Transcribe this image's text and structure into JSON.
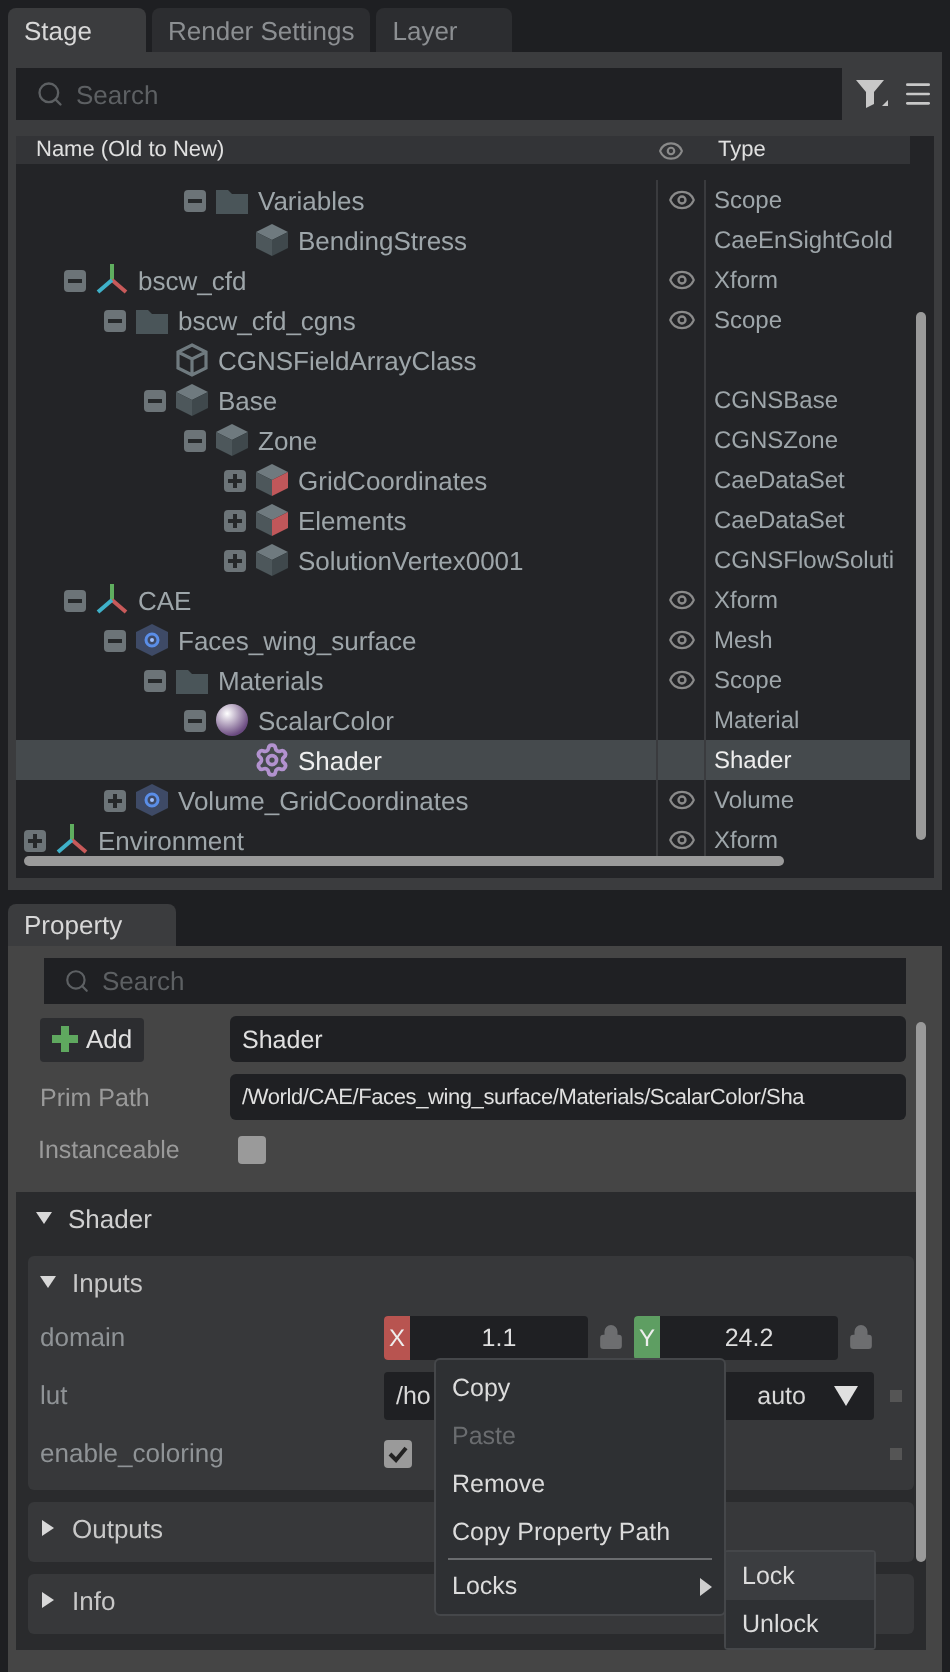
{
  "stage_tabs": [
    {
      "label": "Stage",
      "selected": true
    },
    {
      "label": "Render Settings",
      "selected": false
    },
    {
      "label": "Layer",
      "selected": false
    }
  ],
  "stage_search": {
    "placeholder": "Search"
  },
  "tree_columns": {
    "name": "Name (Old to New)",
    "type": "Type"
  },
  "tree": [
    {
      "children": [
        {
          "children": [
            {
              "children": [
                {
                  "children": [
                    {
                      "name": "Variables",
                      "kind": "folder",
                      "type": "Scope",
                      "visible": true,
                      "selected": false,
                      "expanded": true,
                      "children": [
                        {
                          "name": "BendingStress",
                          "kind": "cube",
                          "type": "CaeEnSightGold",
                          "visible": false,
                          "selected": false
                        }
                      ]
                    }
                  ]
                }
              ]
            }
          ]
        },
        {
          "name": "bscw_cfd",
          "kind": "xform",
          "type": "Xform",
          "visible": true,
          "selected": false,
          "expanded": true,
          "children": [
            {
              "name": "bscw_cfd_cgns",
              "kind": "folder",
              "type": "Scope",
              "visible": true,
              "selected": false,
              "expanded": true,
              "children": [
                {
                  "name": "CGNSFieldArrayClass",
                  "kind": "cube-outline",
                  "visible": false,
                  "selected": false
                },
                {
                  "name": "Base",
                  "kind": "cube",
                  "type": "CGNSBase",
                  "visible": false,
                  "selected": false,
                  "expanded": true,
                  "children": [
                    {
                      "name": "Zone",
                      "kind": "cube",
                      "type": "CGNSZone",
                      "visible": false,
                      "selected": false,
                      "expanded": true,
                      "children": [
                        {
                          "name": "GridCoordinates",
                          "kind": "cube-red",
                          "type": "CaeDataSet",
                          "visible": false,
                          "selected": false,
                          "expanded": false
                        },
                        {
                          "name": "Elements",
                          "kind": "cube-red",
                          "type": "CaeDataSet",
                          "visible": false,
                          "selected": false,
                          "expanded": false
                        },
                        {
                          "name": "SolutionVertex0001",
                          "kind": "cube",
                          "type": "CGNSFlowSoluti",
                          "visible": false,
                          "selected": false,
                          "expanded": false
                        }
                      ]
                    }
                  ]
                }
              ]
            }
          ]
        },
        {
          "name": "CAE",
          "kind": "xform",
          "type": "Xform",
          "visible": true,
          "selected": false,
          "expanded": true,
          "children": [
            {
              "name": "Faces_wing_surface",
              "kind": "mesh",
              "type": "Mesh",
              "visible": true,
              "selected": false,
              "expanded": true,
              "children": [
                {
                  "name": "Materials",
                  "kind": "folder",
                  "type": "Scope",
                  "visible": true,
                  "selected": false,
                  "expanded": true,
                  "children": [
                    {
                      "name": "ScalarColor",
                      "kind": "sphere",
                      "type": "Material",
                      "visible": false,
                      "selected": false,
                      "expanded": true,
                      "children": [
                        {
                          "name": "Shader",
                          "kind": "gear",
                          "type": "Shader",
                          "visible": false,
                          "selected": true
                        }
                      ]
                    }
                  ]
                }
              ]
            },
            {
              "name": "Volume_GridCoordinates",
              "kind": "mesh",
              "type": "Volume",
              "visible": true,
              "selected": false,
              "expanded": false
            }
          ]
        }
      ]
    },
    {
      "name": "Environment",
      "kind": "xform",
      "type": "Xform",
      "visible": true,
      "selected": false,
      "expanded": false
    }
  ],
  "property_tab": {
    "label": "Property",
    "selected": true
  },
  "property_search": {
    "placeholder": "Search"
  },
  "add_button": "Add",
  "prim_name": "Shader",
  "prim_path": {
    "label": "Prim Path",
    "value": "/World/CAE/Faces_wing_surface/Materials/ScalarColor/Sha"
  },
  "instanceable": {
    "label": "Instanceable",
    "checked": false
  },
  "section": {
    "title": "Shader",
    "expanded": true,
    "groups": [
      {
        "title": "Inputs",
        "expanded": true,
        "rows": [
          {
            "kind": "vector",
            "label": "domain",
            "components": [
              {
                "axis": "X",
                "value": "1.1",
                "color": "#b85450"
              },
              {
                "axis": "Y",
                "value": "24.2",
                "color": "#5e9e62"
              }
            ]
          },
          {
            "kind": "asset",
            "label": "lut",
            "value": "/ho",
            "option": "auto"
          },
          {
            "kind": "checkbox",
            "label": "enable_coloring",
            "checked": true
          }
        ]
      },
      {
        "title": "Outputs",
        "expanded": false
      },
      {
        "title": "Info",
        "expanded": false
      }
    ]
  },
  "context_menu": {
    "items": [
      {
        "kind": "action",
        "label": "Copy",
        "disabled": false
      },
      {
        "kind": "action",
        "label": "Paste",
        "disabled": true
      },
      {
        "kind": "action",
        "label": "Remove",
        "disabled": false
      },
      {
        "kind": "action",
        "label": "Copy Property Path",
        "disabled": false
      },
      {
        "kind": "separator"
      },
      {
        "kind": "submenu",
        "label": "Locks",
        "disabled": false
      }
    ],
    "submenu": [
      {
        "label": "Lock",
        "selected": true
      },
      {
        "label": "Unlock",
        "selected": false
      }
    ]
  }
}
